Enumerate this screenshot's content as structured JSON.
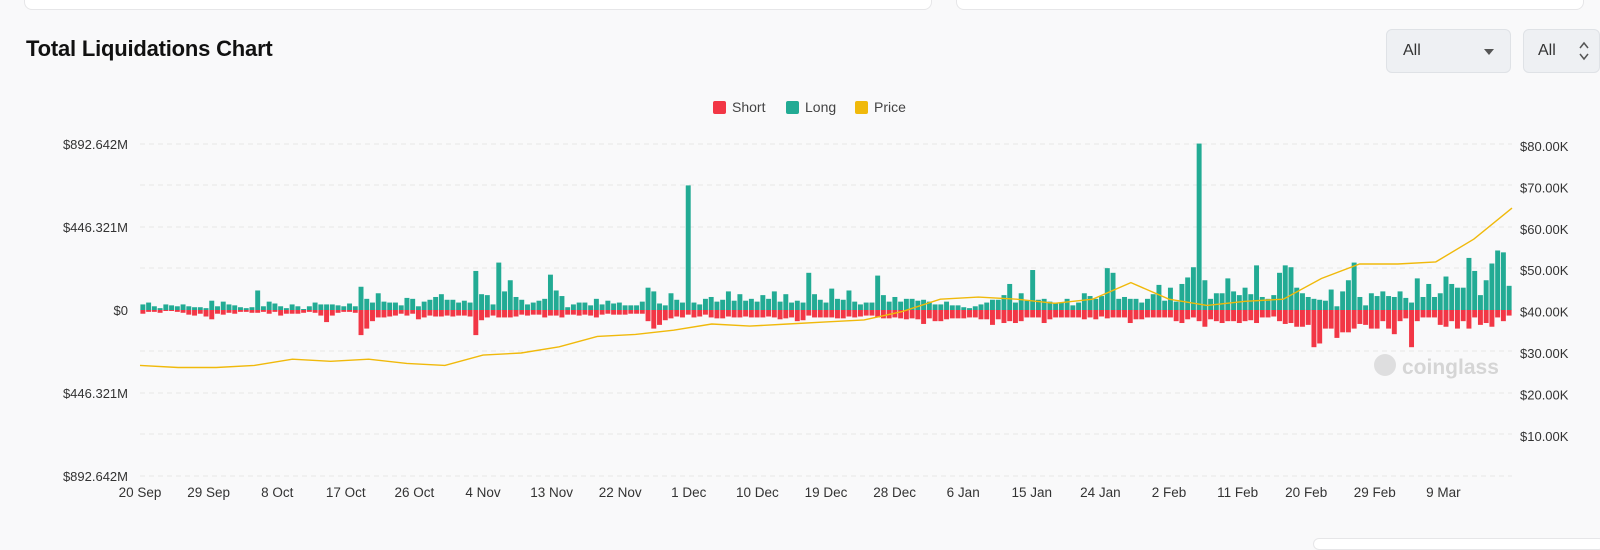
{
  "header": {
    "title": "Total Liquidations Chart",
    "select_range": "All",
    "select_coin": "All"
  },
  "watermark": "coinglass",
  "colors": {
    "short": "#f23645",
    "long": "#22ab94",
    "price": "#f0b90b",
    "grid": "#e6e6e6"
  },
  "chart_data": {
    "type": "bar",
    "title": "",
    "legend": [
      {
        "name": "Short",
        "color": "#f23645"
      },
      {
        "name": "Long",
        "color": "#22ab94"
      },
      {
        "name": "Price",
        "color": "#f0b90b"
      }
    ],
    "legend_position": "top-center",
    "left_axis": {
      "ticks": [
        "$892.642M",
        "$446.321M",
        "$0",
        "$446.321M",
        "$892.642M"
      ],
      "max_million": 892.642
    },
    "right_axis": {
      "ticks": [
        "$80.00K",
        "$70.00K",
        "$60.00K",
        "$50.00K",
        "$40.00K",
        "$30.00K",
        "$20.00K",
        "$10.00K"
      ],
      "range_k": [
        0,
        80
      ]
    },
    "x_tick_labels": [
      "20 Sep",
      "29 Sep",
      "8 Oct",
      "17 Oct",
      "26 Oct",
      "4 Nov",
      "13 Nov",
      "22 Nov",
      "1 Dec",
      "10 Dec",
      "19 Dec",
      "28 Dec",
      "6 Jan",
      "15 Jan",
      "24 Jan",
      "2 Feb",
      "11 Feb",
      "20 Feb",
      "29 Feb",
      "9 Mar"
    ],
    "start_date": "20 Sep",
    "days": 180,
    "grid": "horizontal dashed",
    "series": [
      {
        "name": "Long",
        "unit": "USD millions",
        "values": [
          30,
          40,
          20,
          10,
          30,
          25,
          20,
          30,
          20,
          15,
          15,
          10,
          50,
          20,
          45,
          30,
          25,
          15,
          10,
          15,
          105,
          20,
          45,
          35,
          20,
          10,
          30,
          20,
          5,
          20,
          40,
          30,
          30,
          30,
          25,
          20,
          35,
          20,
          125,
          60,
          40,
          90,
          45,
          40,
          40,
          25,
          65,
          60,
          20,
          45,
          55,
          70,
          85,
          55,
          55,
          40,
          50,
          40,
          210,
          85,
          80,
          30,
          255,
          100,
          160,
          70,
          55,
          30,
          40,
          50,
          60,
          190,
          105,
          75,
          15,
          30,
          40,
          40,
          25,
          60,
          30,
          50,
          35,
          40,
          25,
          25,
          25,
          45,
          120,
          100,
          35,
          25,
          90,
          55,
          40,
          670,
          40,
          30,
          60,
          70,
          45,
          55,
          100,
          50,
          85,
          50,
          60,
          45,
          80,
          60,
          100,
          45,
          85,
          40,
          50,
          40,
          200,
          85,
          55,
          40,
          115,
          60,
          55,
          105,
          45,
          30,
          40,
          40,
          185,
          80,
          45,
          70,
          45,
          60,
          60,
          50,
          55,
          45,
          30,
          30,
          45,
          25,
          25,
          15,
          10,
          20,
          30,
          40,
          55,
          55,
          80,
          140,
          40,
          90,
          50,
          215,
          55,
          60,
          45,
          40,
          40,
          60,
          25,
          40,
          90,
          75,
          60,
          75,
          225,
          200,
          60,
          70,
          60,
          60,
          40,
          60,
          85,
          135,
          50,
          120,
          45,
          140,
          175,
          230,
          895,
          160,
          60,
          90,
          90,
          170,
          100,
          80,
          120,
          85,
          240,
          70,
          60,
          80,
          200,
          240,
          230,
          120,
          90,
          70,
          60,
          55,
          50,
          110,
          20,
          100,
          160,
          255,
          70,
          25,
          90,
          75,
          100,
          75,
          70,
          100,
          65,
          40,
          170,
          70,
          140,
          70,
          90,
          180,
          140,
          120,
          120,
          280,
          210,
          80,
          160,
          250,
          320,
          310,
          130
        ],
        "color": "#22ab94"
      },
      {
        "name": "Short",
        "unit": "USD millions",
        "values": [
          20,
          10,
          10,
          15,
          5,
          5,
          10,
          15,
          25,
          30,
          20,
          35,
          50,
          20,
          25,
          15,
          20,
          10,
          10,
          15,
          15,
          10,
          20,
          10,
          30,
          20,
          20,
          20,
          15,
          10,
          15,
          30,
          65,
          30,
          15,
          10,
          10,
          15,
          135,
          100,
          60,
          40,
          40,
          35,
          30,
          20,
          30,
          20,
          50,
          40,
          30,
          35,
          35,
          30,
          35,
          30,
          30,
          35,
          135,
          55,
          40,
          30,
          40,
          40,
          40,
          35,
          25,
          30,
          25,
          25,
          40,
          30,
          30,
          40,
          25,
          25,
          30,
          25,
          30,
          40,
          25,
          20,
          25,
          25,
          25,
          20,
          20,
          20,
          60,
          100,
          80,
          55,
          45,
          35,
          40,
          25,
          40,
          35,
          25,
          40,
          45,
          45,
          35,
          40,
          40,
          35,
          40,
          40,
          40,
          35,
          40,
          50,
          45,
          40,
          60,
          55,
          30,
          40,
          40,
          40,
          40,
          45,
          45,
          35,
          40,
          35,
          30,
          30,
          40,
          45,
          45,
          40,
          45,
          50,
          45,
          50,
          75,
          45,
          60,
          60,
          50,
          45,
          45,
          45,
          40,
          40,
          50,
          50,
          80,
          50,
          70,
          60,
          70,
          60,
          40,
          40,
          40,
          70,
          50,
          40,
          40,
          40,
          40,
          40,
          50,
          40,
          50,
          35,
          45,
          40,
          40,
          40,
          70,
          50,
          50,
          40,
          40,
          40,
          40,
          40,
          60,
          70,
          50,
          40,
          60,
          90,
          50,
          60,
          70,
          60,
          60,
          70,
          60,
          55,
          70,
          40,
          40,
          35,
          60,
          75,
          70,
          90,
          90,
          80,
          200,
          180,
          100,
          100,
          150,
          120,
          120,
          100,
          75,
          80,
          100,
          100,
          60,
          100,
          130,
          60,
          45,
          200,
          60,
          40,
          40,
          40,
          80,
          90,
          60,
          100,
          60,
          100,
          40,
          80,
          70,
          90,
          40,
          60,
          30
        ],
        "color": "#f23645"
      },
      {
        "name": "Price",
        "unit": "USD thousands",
        "x_day": [
          0,
          5,
          10,
          15,
          20,
          25,
          30,
          35,
          40,
          45,
          50,
          55,
          60,
          65,
          70,
          75,
          80,
          85,
          90,
          95,
          100,
          105,
          110,
          115,
          120,
          125,
          130,
          135,
          140,
          145,
          150,
          155,
          160,
          165,
          170,
          175,
          180
        ],
        "values": [
          27.0,
          26.5,
          26.5,
          27.0,
          28.5,
          28.0,
          28.5,
          27.5,
          27.0,
          29.5,
          30.0,
          31.5,
          34.0,
          34.5,
          35.5,
          37.0,
          36.5,
          37.0,
          37.5,
          38.0,
          40.0,
          43.0,
          43.5,
          43.0,
          42.0,
          43.0,
          47.0,
          43.0,
          41.5,
          42.5,
          43.0,
          48.0,
          51.5,
          51.5,
          52.0,
          57.5,
          65.0
        ],
        "color": "#f0b90b"
      }
    ]
  }
}
